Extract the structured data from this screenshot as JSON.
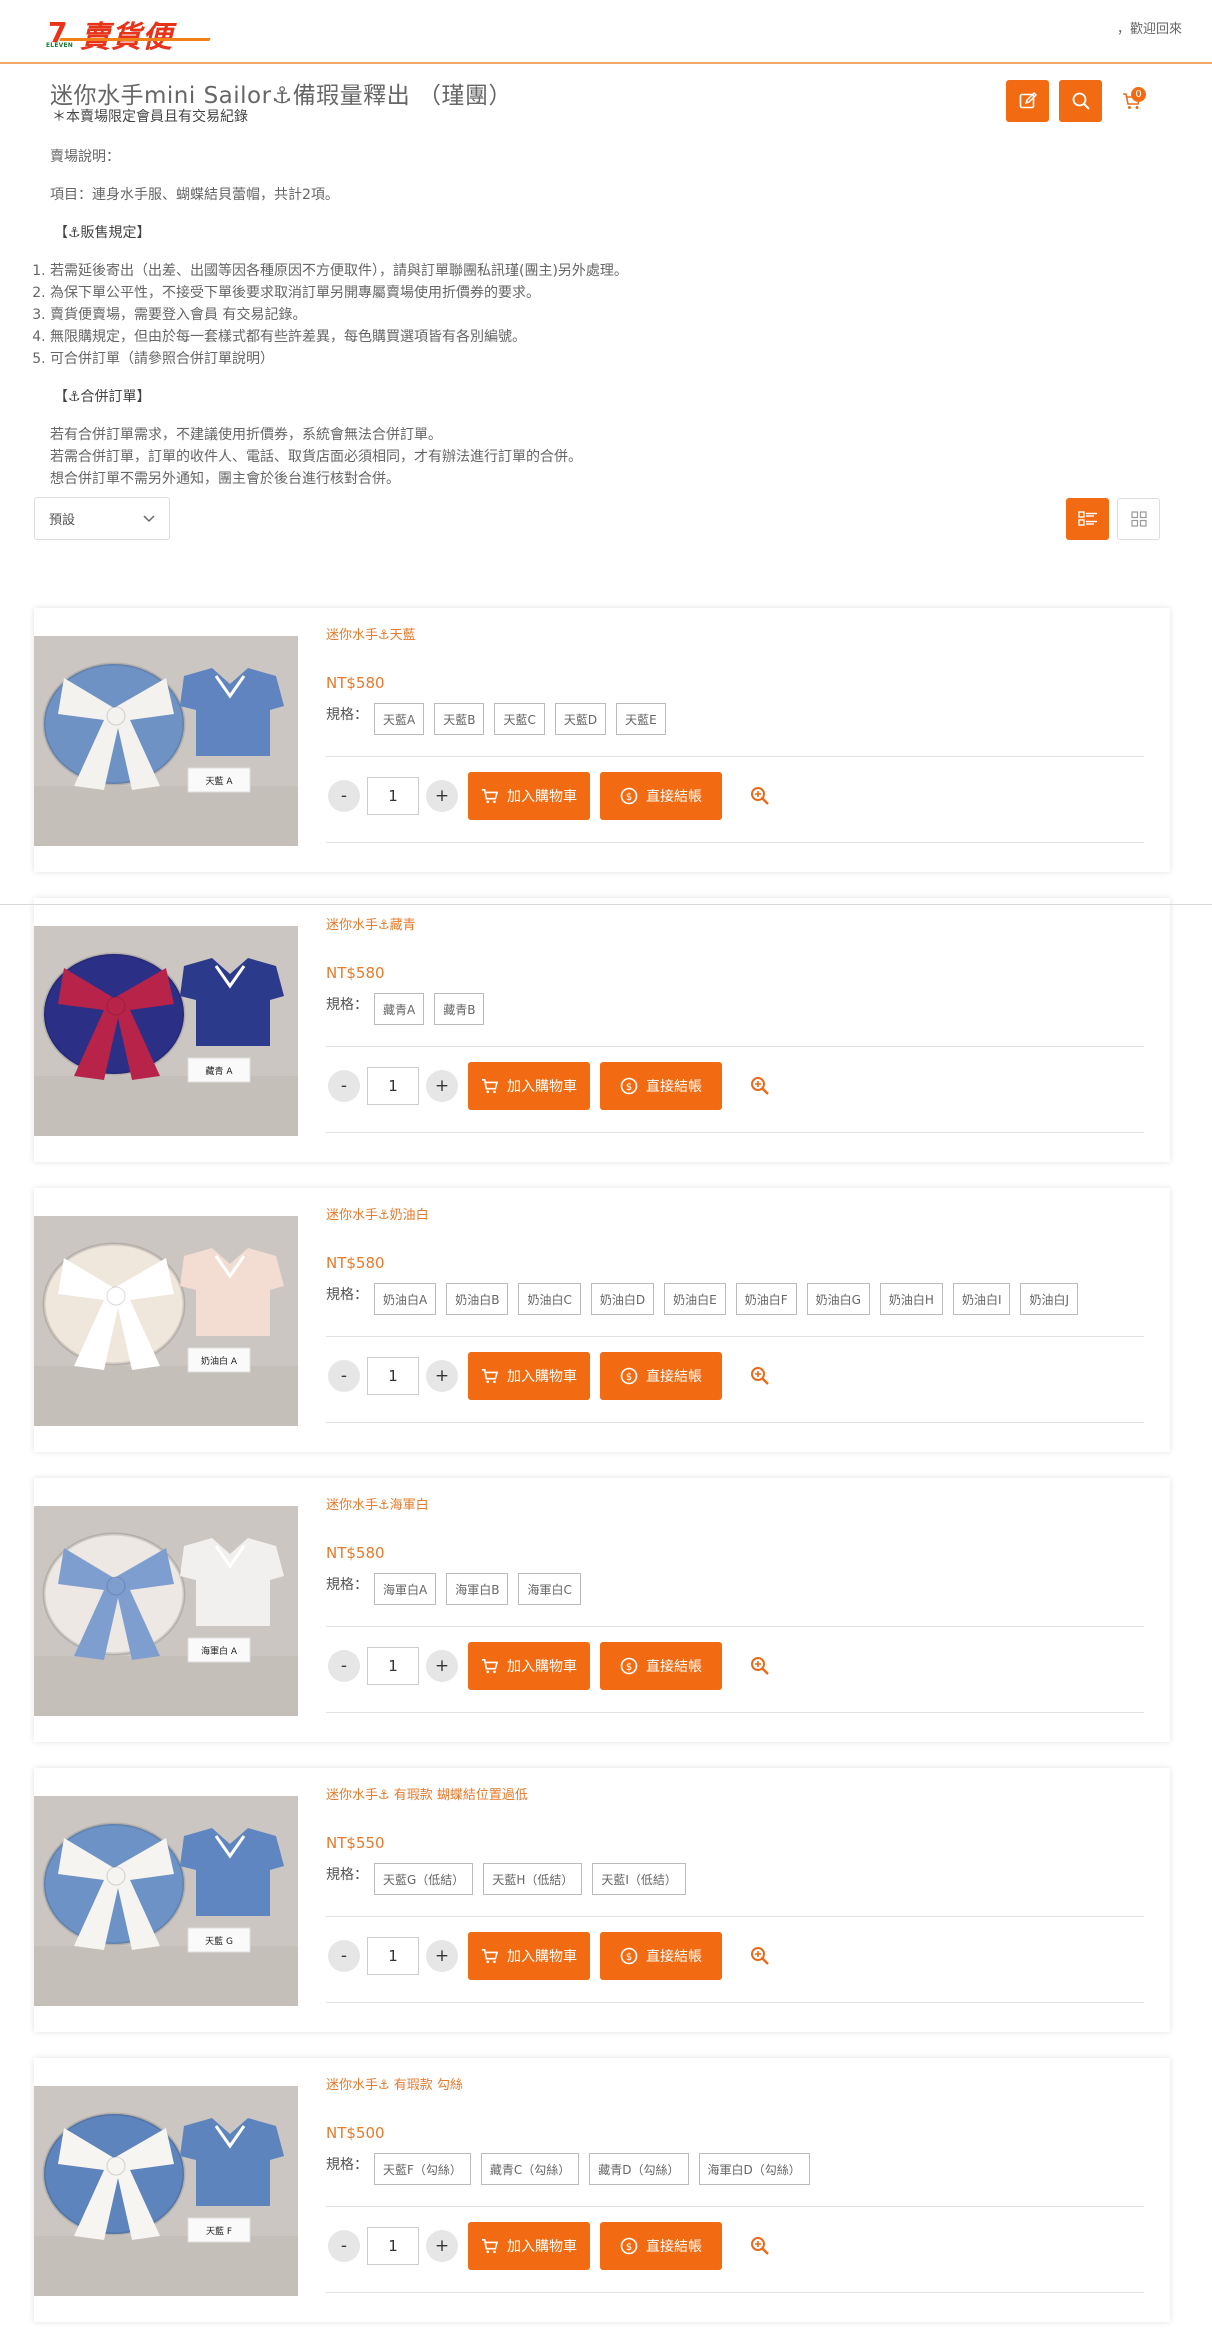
{
  "header": {
    "logo_numeral": "7",
    "logo_subtext": "ELEVEN",
    "logo_text": "賣貨便",
    "welcome": "，歡迎回來",
    "cart_count": "0"
  },
  "page": {
    "title": "迷你水手mini Sailor⚓備瑕量釋出 （瑾團）",
    "subtitle": "＊本賣場限定會員且有交易紀錄"
  },
  "description": {
    "intro_label": "賣場說明：",
    "items_line": "項目：連身水手服、蝴蝶結貝蕾帽，共計2項。",
    "rules_heading": "【⚓販售規定】",
    "rules": [
      "若需延後寄出（出差、出國等因各種原因不方便取件），請與訂單聯團私訊瑾(團主)另外處理。",
      "為保下單公平性，不接受下單後要求取消訂單另開專屬賣場使用折價券的要求。",
      "賣貨便賣場，需要登入會員 有交易記錄。",
      "無限購規定，但由於每一套樣式都有些許差異，每色購買選項皆有各別編號。",
      "可合併訂單（請參照合併訂單說明）"
    ],
    "merge_heading": "【⚓合併訂單】",
    "merge_lines": [
      "若有合併訂單需求，不建議使用折價券，系統會無法合併訂單。",
      "若需合併訂單，訂單的收件人、電話、取貨店面必須相同，才有辦法進行訂單的合併。",
      "想合併訂單不需另外通知，團主會於後台進行核對合併。"
    ]
  },
  "sort": {
    "selected": "預設"
  },
  "product_labels": {
    "spec_label": "規格：",
    "add_to_cart": "加入購物車",
    "checkout": "直接結帳",
    "qty": "1",
    "minus": "-",
    "plus": "+"
  },
  "products": [
    {
      "name": "迷你水手⚓天藍",
      "price": "NT$580",
      "specs": [
        "天藍A",
        "天藍B",
        "天藍C",
        "天藍D",
        "天藍E"
      ],
      "photo_tag": "天藍 A",
      "hat_color": "#6f92c4",
      "bow_color": "#f4f2ee",
      "top_color": "#5f84bf"
    },
    {
      "name": "迷你水手⚓藏青",
      "price": "NT$580",
      "specs": [
        "藏青A",
        "藏青B"
      ],
      "photo_tag": "藏青 A",
      "hat_color": "#2b2f86",
      "bow_color": "#b8234a",
      "top_color": "#2c3a8c"
    },
    {
      "name": "迷你水手⚓奶油白",
      "price": "NT$580",
      "specs": [
        "奶油白A",
        "奶油白B",
        "奶油白C",
        "奶油白D",
        "奶油白E",
        "奶油白F",
        "奶油白G",
        "奶油白H",
        "奶油白I",
        "奶油白J"
      ],
      "photo_tag": "奶油白 A",
      "hat_color": "#efe6dc",
      "bow_color": "#ffffff",
      "top_color": "#f3ddd2"
    },
    {
      "name": "迷你水手⚓海軍白",
      "price": "NT$580",
      "specs": [
        "海軍白A",
        "海軍白B",
        "海軍白C"
      ],
      "photo_tag": "海軍白 A",
      "hat_color": "#ede8e3",
      "bow_color": "#7f9ed0",
      "top_color": "#f2f0ee"
    },
    {
      "name": "迷你水手⚓ 有瑕款 蝴蝶結位置過低",
      "price": "NT$550",
      "specs": [
        "天藍G（低結）",
        "天藍H（低結）",
        "天藍I（低結）"
      ],
      "photo_tag": "天藍 G",
      "hat_color": "#6d93c6",
      "bow_color": "#f6f4f0",
      "top_color": "#5f86c0"
    },
    {
      "name": "迷你水手⚓ 有瑕款 勾絲",
      "price": "NT$500",
      "specs": [
        "天藍F（勾絲）",
        "藏青C（勾絲）",
        "藏青D（勾絲）",
        "海軍白D（勾絲）"
      ],
      "photo_tag": "天藍 F",
      "hat_color": "#5d84bd",
      "bow_color": "#f7f5f1",
      "top_color": "#5d84bd"
    }
  ]
}
